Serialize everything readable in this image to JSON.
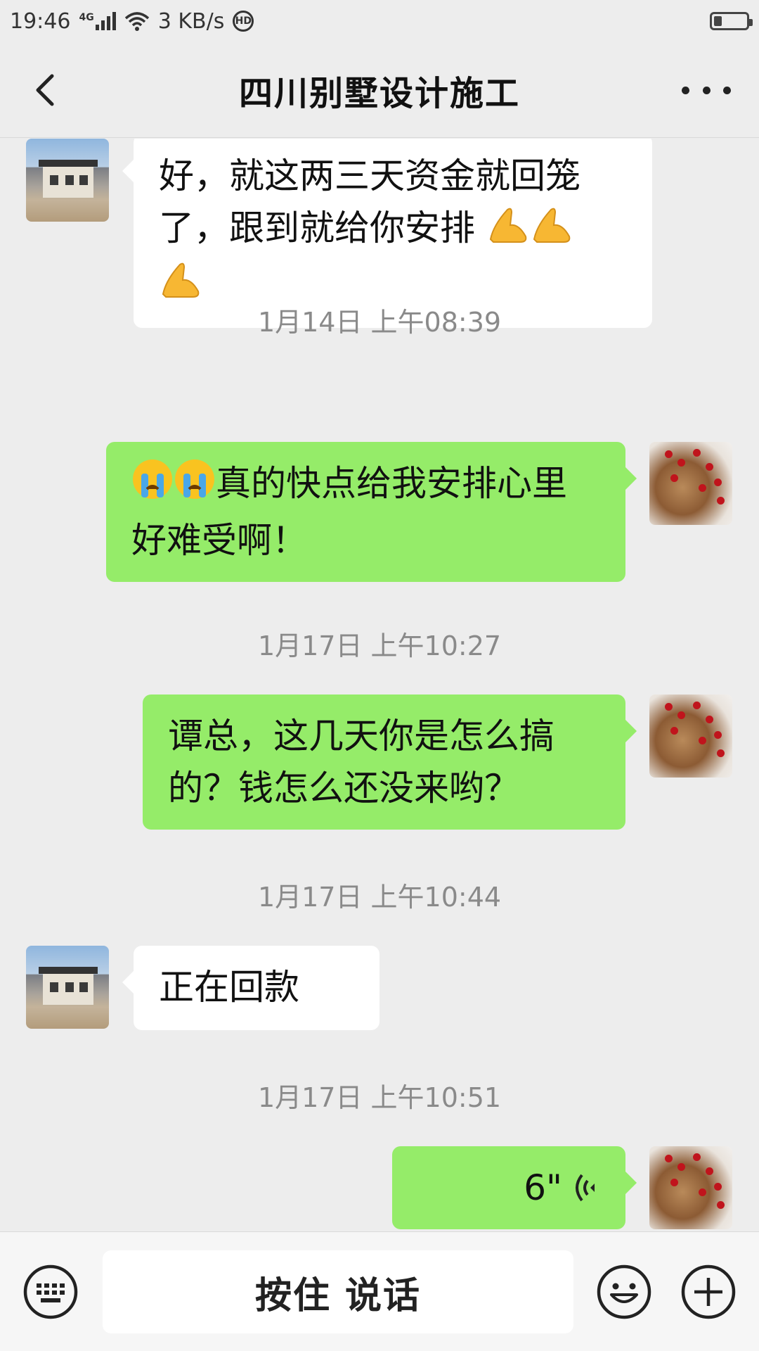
{
  "status_bar": {
    "time": "19:46",
    "network": "4G",
    "speed": "3 KB/s",
    "hd": "HD",
    "battery_level": 0.26
  },
  "header": {
    "title": "四川别墅设计施工",
    "back_icon": "chevron-left-icon",
    "more_icon": "more-dots-icon"
  },
  "messages": [
    {
      "side": "left",
      "text_line1": "好，就这两三天资金就回笼",
      "text_line2": "了，跟到就给你安排"
    },
    {
      "timestamp": "1月14日 上午08:39"
    },
    {
      "side": "right",
      "text_line1": "真的快点给我安排心里",
      "text_line2": "好难受啊！"
    },
    {
      "timestamp": "1月17日 上午10:27"
    },
    {
      "side": "right",
      "text_line1": "谭总，这几天你是怎么搞",
      "text_line2": "的？钱怎么还没来哟？"
    },
    {
      "timestamp": "1月17日 上午10:44"
    },
    {
      "side": "left",
      "text": "正在回款"
    },
    {
      "timestamp": "1月17日 上午10:51"
    },
    {
      "side": "right",
      "voice_duration": "6\""
    }
  ],
  "bottom_bar": {
    "hold_to_talk": "按住 说话",
    "keyboard_icon": "keyboard-icon",
    "emoji_icon": "smiley-icon",
    "plus_icon": "plus-icon"
  }
}
